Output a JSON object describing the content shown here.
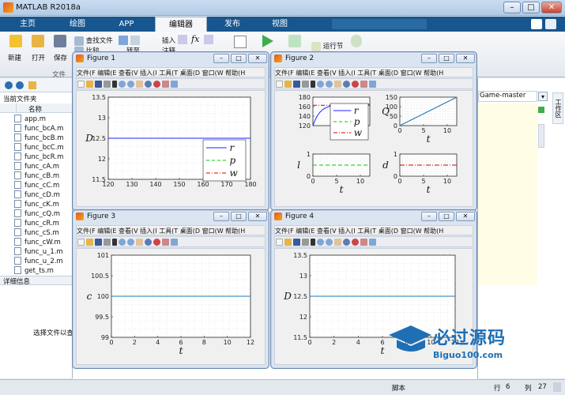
{
  "window": {
    "title": "MATLAB R2018a"
  },
  "tabs": [
    {
      "label": "主页"
    },
    {
      "label": "绘图"
    },
    {
      "label": "APP"
    },
    {
      "label": "编辑器"
    },
    {
      "label": "发布"
    },
    {
      "label": "视图"
    }
  ],
  "search": {
    "placeholder": "搜索文档"
  },
  "ribbon": {
    "new": "新建",
    "open": "打开",
    "save": "保存",
    "find_files": "查找文件",
    "compare": "比较",
    "insert": "插入",
    "fx": "fx",
    "comment": "注释",
    "goto": "转至",
    "run_section": "运行节",
    "group_file": "文件"
  },
  "left_panel": {
    "header": "当前文件夹",
    "name_col": "名称",
    "files": [
      "app.m",
      "func_bcA.m",
      "func_bcB.m",
      "func_bcC.m",
      "func_bcR.m",
      "func_cA.m",
      "func_cB.m",
      "func_cC.m",
      "func_cD.m",
      "func_cK.m",
      "func_cQ.m",
      "func_cR.m",
      "func_cS.m",
      "func_cW.m",
      "func_u_1.m",
      "func_u_2.m",
      "get_ts.m"
    ],
    "details_header": "详细信息",
    "details_text": "选择文件以查"
  },
  "right_panel": {
    "path_fragment": "Game-master",
    "side_label": "工作区"
  },
  "figure_menu": [
    "文件(F",
    "编辑(E",
    "查看(V",
    "插入(I",
    "工具(T",
    "桌面(D",
    "窗口(W",
    "帮助(H"
  ],
  "figures": [
    {
      "title": "Figure 1"
    },
    {
      "title": "Figure 2"
    },
    {
      "title": "Figure 3"
    },
    {
      "title": "Figure 4"
    }
  ],
  "chart_data": [
    {
      "type": "line",
      "figure": "Figure 1",
      "xlim": [
        120,
        180
      ],
      "ylim": [
        11.5,
        13.5
      ],
      "xticks": [
        120,
        130,
        140,
        150,
        160,
        170,
        180
      ],
      "yticks": [
        11.5,
        12,
        12.5,
        13,
        13.5
      ],
      "ylabel": "D",
      "series": [
        {
          "name": "r",
          "x": [
            120,
            180
          ],
          "y": [
            12.5,
            12.5
          ],
          "color": "#1f1fff"
        }
      ],
      "legend": [
        "r",
        "p",
        "w"
      ],
      "legend_colors": [
        "#1f1fff",
        "#00cc00",
        "#cc0000"
      ],
      "legend_placement": "bottom-right",
      "grid": true
    },
    {
      "type": "line",
      "figure": "Figure 2 (top-left)",
      "ylim": [
        120,
        180
      ],
      "yticks": [
        120,
        140,
        160,
        180
      ],
      "legend": [
        "r",
        "p",
        "w"
      ],
      "legend_colors": [
        "#1f1fff",
        "#00cc00",
        "#cc0000"
      ],
      "grid": true
    },
    {
      "type": "line",
      "figure": "Figure 2 (top-right)",
      "xlim": [
        0,
        12
      ],
      "ylim": [
        0,
        150
      ],
      "xticks": [
        0,
        5,
        10
      ],
      "yticks": [
        0,
        50,
        100,
        150
      ],
      "xlabel": "t",
      "ylabel": "Q",
      "series": [
        {
          "x": [
            0,
            12
          ],
          "y": [
            0,
            150
          ],
          "color": "#1f77b4"
        }
      ],
      "grid": true
    },
    {
      "type": "line",
      "figure": "Figure 2 (bottom-left)",
      "xlim": [
        0,
        12
      ],
      "ylim": [
        0,
        1
      ],
      "xticks": [
        0,
        5,
        10
      ],
      "yticks": [
        0,
        1
      ],
      "xlabel": "t",
      "ylabel": "l",
      "series": [
        {
          "x": [
            0,
            12
          ],
          "y": [
            0.5,
            0.5
          ],
          "color": "#00cc00",
          "style": "dashed"
        }
      ],
      "grid": true
    },
    {
      "type": "line",
      "figure": "Figure 2 (bottom-right)",
      "xlim": [
        0,
        12
      ],
      "ylim": [
        0,
        1
      ],
      "xticks": [
        0,
        5,
        10
      ],
      "yticks": [
        0,
        1
      ],
      "xlabel": "t",
      "ylabel": "d",
      "series": [
        {
          "x": [
            0,
            12
          ],
          "y": [
            0.5,
            0.5
          ],
          "color": "#cc0000",
          "style": "dashdot"
        }
      ],
      "grid": true
    },
    {
      "type": "line",
      "figure": "Figure 3",
      "xlim": [
        0,
        12
      ],
      "ylim": [
        99,
        101
      ],
      "xticks": [
        0,
        2,
        4,
        6,
        8,
        10,
        12
      ],
      "yticks": [
        99,
        99.5,
        100,
        100.5,
        101
      ],
      "xlabel": "t",
      "ylabel": "c",
      "series": [
        {
          "x": [
            0,
            12
          ],
          "y": [
            100,
            100
          ],
          "color": "#1f77b4"
        }
      ],
      "grid": true
    },
    {
      "type": "line",
      "figure": "Figure 4",
      "xlim": [
        0,
        12
      ],
      "ylim": [
        11.5,
        13.5
      ],
      "xticks": [
        0,
        2,
        4,
        6,
        8,
        10,
        12
      ],
      "yticks": [
        11.5,
        12,
        12.5,
        13,
        13.5
      ],
      "xlabel": "t",
      "ylabel": "D",
      "series": [
        {
          "x": [
            0,
            12
          ],
          "y": [
            12.5,
            12.5
          ],
          "color": "#1f77b4"
        }
      ],
      "grid": true
    }
  ],
  "status": {
    "script_label": "脚本",
    "row_label": "行",
    "row_value": "6",
    "col_label": "列",
    "col_value": "27"
  },
  "watermark": {
    "text": "必过源码",
    "subtext": "Biguo100.com"
  }
}
